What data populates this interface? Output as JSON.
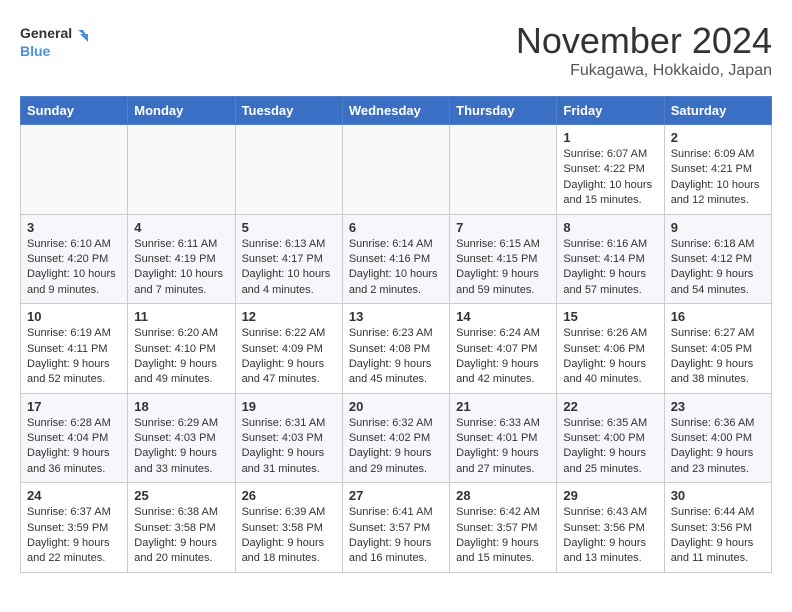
{
  "logo": {
    "line1": "General",
    "line2": "Blue"
  },
  "title": "November 2024",
  "location": "Fukagawa, Hokkaido, Japan",
  "weekdays": [
    "Sunday",
    "Monday",
    "Tuesday",
    "Wednesday",
    "Thursday",
    "Friday",
    "Saturday"
  ],
  "weeks": [
    [
      {
        "day": "",
        "info": ""
      },
      {
        "day": "",
        "info": ""
      },
      {
        "day": "",
        "info": ""
      },
      {
        "day": "",
        "info": ""
      },
      {
        "day": "",
        "info": ""
      },
      {
        "day": "1",
        "info": "Sunrise: 6:07 AM\nSunset: 4:22 PM\nDaylight: 10 hours and 15 minutes."
      },
      {
        "day": "2",
        "info": "Sunrise: 6:09 AM\nSunset: 4:21 PM\nDaylight: 10 hours and 12 minutes."
      }
    ],
    [
      {
        "day": "3",
        "info": "Sunrise: 6:10 AM\nSunset: 4:20 PM\nDaylight: 10 hours and 9 minutes."
      },
      {
        "day": "4",
        "info": "Sunrise: 6:11 AM\nSunset: 4:19 PM\nDaylight: 10 hours and 7 minutes."
      },
      {
        "day": "5",
        "info": "Sunrise: 6:13 AM\nSunset: 4:17 PM\nDaylight: 10 hours and 4 minutes."
      },
      {
        "day": "6",
        "info": "Sunrise: 6:14 AM\nSunset: 4:16 PM\nDaylight: 10 hours and 2 minutes."
      },
      {
        "day": "7",
        "info": "Sunrise: 6:15 AM\nSunset: 4:15 PM\nDaylight: 9 hours and 59 minutes."
      },
      {
        "day": "8",
        "info": "Sunrise: 6:16 AM\nSunset: 4:14 PM\nDaylight: 9 hours and 57 minutes."
      },
      {
        "day": "9",
        "info": "Sunrise: 6:18 AM\nSunset: 4:12 PM\nDaylight: 9 hours and 54 minutes."
      }
    ],
    [
      {
        "day": "10",
        "info": "Sunrise: 6:19 AM\nSunset: 4:11 PM\nDaylight: 9 hours and 52 minutes."
      },
      {
        "day": "11",
        "info": "Sunrise: 6:20 AM\nSunset: 4:10 PM\nDaylight: 9 hours and 49 minutes."
      },
      {
        "day": "12",
        "info": "Sunrise: 6:22 AM\nSunset: 4:09 PM\nDaylight: 9 hours and 47 minutes."
      },
      {
        "day": "13",
        "info": "Sunrise: 6:23 AM\nSunset: 4:08 PM\nDaylight: 9 hours and 45 minutes."
      },
      {
        "day": "14",
        "info": "Sunrise: 6:24 AM\nSunset: 4:07 PM\nDaylight: 9 hours and 42 minutes."
      },
      {
        "day": "15",
        "info": "Sunrise: 6:26 AM\nSunset: 4:06 PM\nDaylight: 9 hours and 40 minutes."
      },
      {
        "day": "16",
        "info": "Sunrise: 6:27 AM\nSunset: 4:05 PM\nDaylight: 9 hours and 38 minutes."
      }
    ],
    [
      {
        "day": "17",
        "info": "Sunrise: 6:28 AM\nSunset: 4:04 PM\nDaylight: 9 hours and 36 minutes."
      },
      {
        "day": "18",
        "info": "Sunrise: 6:29 AM\nSunset: 4:03 PM\nDaylight: 9 hours and 33 minutes."
      },
      {
        "day": "19",
        "info": "Sunrise: 6:31 AM\nSunset: 4:03 PM\nDaylight: 9 hours and 31 minutes."
      },
      {
        "day": "20",
        "info": "Sunrise: 6:32 AM\nSunset: 4:02 PM\nDaylight: 9 hours and 29 minutes."
      },
      {
        "day": "21",
        "info": "Sunrise: 6:33 AM\nSunset: 4:01 PM\nDaylight: 9 hours and 27 minutes."
      },
      {
        "day": "22",
        "info": "Sunrise: 6:35 AM\nSunset: 4:00 PM\nDaylight: 9 hours and 25 minutes."
      },
      {
        "day": "23",
        "info": "Sunrise: 6:36 AM\nSunset: 4:00 PM\nDaylight: 9 hours and 23 minutes."
      }
    ],
    [
      {
        "day": "24",
        "info": "Sunrise: 6:37 AM\nSunset: 3:59 PM\nDaylight: 9 hours and 22 minutes."
      },
      {
        "day": "25",
        "info": "Sunrise: 6:38 AM\nSunset: 3:58 PM\nDaylight: 9 hours and 20 minutes."
      },
      {
        "day": "26",
        "info": "Sunrise: 6:39 AM\nSunset: 3:58 PM\nDaylight: 9 hours and 18 minutes."
      },
      {
        "day": "27",
        "info": "Sunrise: 6:41 AM\nSunset: 3:57 PM\nDaylight: 9 hours and 16 minutes."
      },
      {
        "day": "28",
        "info": "Sunrise: 6:42 AM\nSunset: 3:57 PM\nDaylight: 9 hours and 15 minutes."
      },
      {
        "day": "29",
        "info": "Sunrise: 6:43 AM\nSunset: 3:56 PM\nDaylight: 9 hours and 13 minutes."
      },
      {
        "day": "30",
        "info": "Sunrise: 6:44 AM\nSunset: 3:56 PM\nDaylight: 9 hours and 11 minutes."
      }
    ]
  ]
}
